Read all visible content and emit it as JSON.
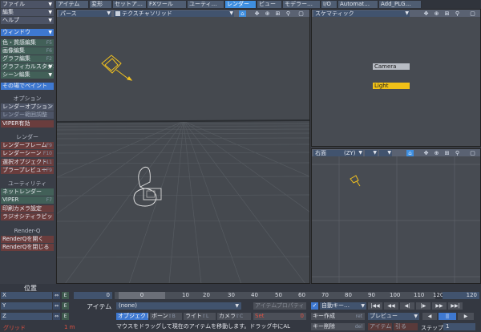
{
  "sidebar": {
    "top": [
      {
        "label": "ファイル",
        "dd": "▼"
      },
      {
        "label": "編集",
        "dd": "▼"
      },
      {
        "label": "ヘルプ",
        "dd": "▼"
      }
    ],
    "window_label": "ウィンドウ",
    "window_dd": "▼",
    "edit_items": [
      {
        "label": "色・質感編集",
        "shortcut": "F5"
      },
      {
        "label": "画像編集",
        "shortcut": "F6"
      },
      {
        "label": "グラフ編集",
        "shortcut": "F2"
      },
      {
        "label": "グラフィカルスタジオ",
        "shortcut": "▼"
      },
      {
        "label": "シーン編集",
        "shortcut": "▼"
      },
      {
        "label": "その場でペイント",
        "shortcut": ""
      }
    ],
    "option_header": "オプション",
    "option_items": [
      {
        "label": "レンダーオプション",
        "shortcut": "P"
      },
      {
        "label": "レンダー範囲調整",
        "shortcut": ""
      },
      {
        "label": "VIPER有効",
        "shortcut": ""
      }
    ],
    "render_header": "レンダー",
    "render_items": [
      {
        "label": "レンダーフレーム",
        "shortcut": "F9"
      },
      {
        "label": "レンダーシーン",
        "shortcut": "F10"
      },
      {
        "label": "選択オブジェクト",
        "shortcut": "F11"
      },
      {
        "label": "プラープレビュー",
        "shortcut": "⇧F9"
      }
    ],
    "utility_header": "ユーティリティ",
    "utility_items": [
      {
        "label": "ネットレンダー",
        "shortcut": ""
      },
      {
        "label": "VIPER",
        "shortcut": "F7"
      },
      {
        "label": "印刷カメラ設定",
        "shortcut": ""
      },
      {
        "label": "ラジオシティラピッド",
        "shortcut": ""
      }
    ],
    "renderq_header": "Render-Q",
    "renderq_items": [
      {
        "label": "RenderQを開く",
        "shortcut": ""
      },
      {
        "label": "RenderQを閉じる",
        "shortcut": ""
      }
    ]
  },
  "top_tabs": [
    "アイテム",
    "変形",
    "セットア…",
    "FXツール",
    "ユーティ…",
    "レンダー",
    "ビュー",
    "モデラー…",
    "I/O",
    "Automat…",
    "Add_PLG…"
  ],
  "active_tab": "レンダー",
  "viewports": {
    "main": {
      "view": "パース",
      "view_dd": "▼",
      "mode": "テクスチャソリッド",
      "mode_dd": "▼"
    },
    "schematic": {
      "view": "スケマティック",
      "view_dd": "▼",
      "nodes": {
        "camera": "Camera",
        "light": "Light"
      }
    },
    "right": {
      "view": "右面",
      "axis": "(ZY)",
      "axis_dd": "▼",
      "mode_dd": "▼"
    }
  },
  "icons": {
    "home": "⌂",
    "move": "✥",
    "rotate": "⊕",
    "zoom": "⊞",
    "search": "⚲",
    "maximize": "▢"
  },
  "position": {
    "label": "位置",
    "axes": [
      {
        "axis": "X",
        "lock": "⇔",
        "env": "E"
      },
      {
        "axis": "Y",
        "lock": "⇔",
        "env": "E"
      },
      {
        "axis": "Z",
        "lock": "⇔",
        "env": "E"
      }
    ],
    "grid_label": "グリッド",
    "grid_value": "1 m"
  },
  "timeline": {
    "start": "0",
    "current": "0",
    "ticks": [
      "0",
      "10",
      "20",
      "30",
      "40",
      "50",
      "60",
      "70",
      "80",
      "90",
      "100",
      "110",
      "120"
    ],
    "end": "120"
  },
  "item_bar": {
    "label": "アイテム",
    "value": "(none)",
    "dd": "▼",
    "props": "アイテムプロパティ",
    "auto_key_check": "✓",
    "auto_key": "自動キー…",
    "auto_key_dd": "▼"
  },
  "type_buttons": [
    {
      "label": "オブジェクト",
      "shortcut": "⇧O"
    },
    {
      "label": "ボーン",
      "shortcut": "⇧B"
    },
    {
      "label": "ライト",
      "shortcut": "⇧L"
    },
    {
      "label": "カメラ",
      "shortcut": "⇧C"
    }
  ],
  "set_button": {
    "label": "Set",
    "value": "0"
  },
  "key_create": {
    "label": "キー作成",
    "shortcut": "ret"
  },
  "key_delete": {
    "label": "キー削除",
    "shortcut": "del"
  },
  "preview": {
    "label": "プレビュー",
    "dd": "▼"
  },
  "anim": {
    "props": "アイテム",
    "dope": "引る",
    "step_label": "ステップ",
    "step_value": "1"
  },
  "playback": [
    "|◀◀",
    "◀◀",
    "◀|",
    "|▶",
    "▶▶",
    "▶▶|",
    "◀",
    "||",
    "▶"
  ],
  "status": "マウスをドラッグして現在のアイテムを移動します。ドラッグ中にAL"
}
